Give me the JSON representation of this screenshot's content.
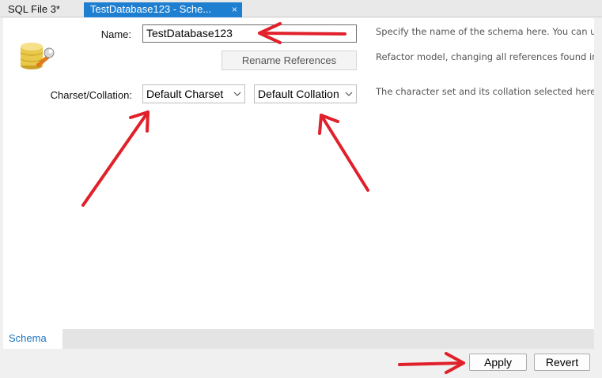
{
  "tabs": [
    {
      "label": "SQL File 3*"
    },
    {
      "label": "TestDatabase123 - Sche...",
      "close_glyph": "×"
    }
  ],
  "schema_form": {
    "name_label": "Name:",
    "name_value": "TestDatabase123",
    "rename_button": "Rename References",
    "charset_label": "Charset/Collation:",
    "charset_value": "Default Charset",
    "collation_value": "Default Collation"
  },
  "hints": {
    "name_hint": "Specify the name of the schema here. You can us",
    "rename_hint": "Refactor model, changing all references found in v",
    "charset_hint": "The character set and its collation selected here w"
  },
  "bottom_tabs": [
    {
      "label": "Schema"
    }
  ],
  "actions": {
    "apply_label": "Apply",
    "revert_label": "Revert"
  },
  "icons": {
    "schema_icon": "database-wrench-icon",
    "chevron": "chevron-down-icon",
    "annotation": "red-arrow"
  },
  "colors": {
    "active_tab": "#1e7fd1",
    "arrow": "#e0202a",
    "schema_tab_text": "#1a73c0"
  }
}
